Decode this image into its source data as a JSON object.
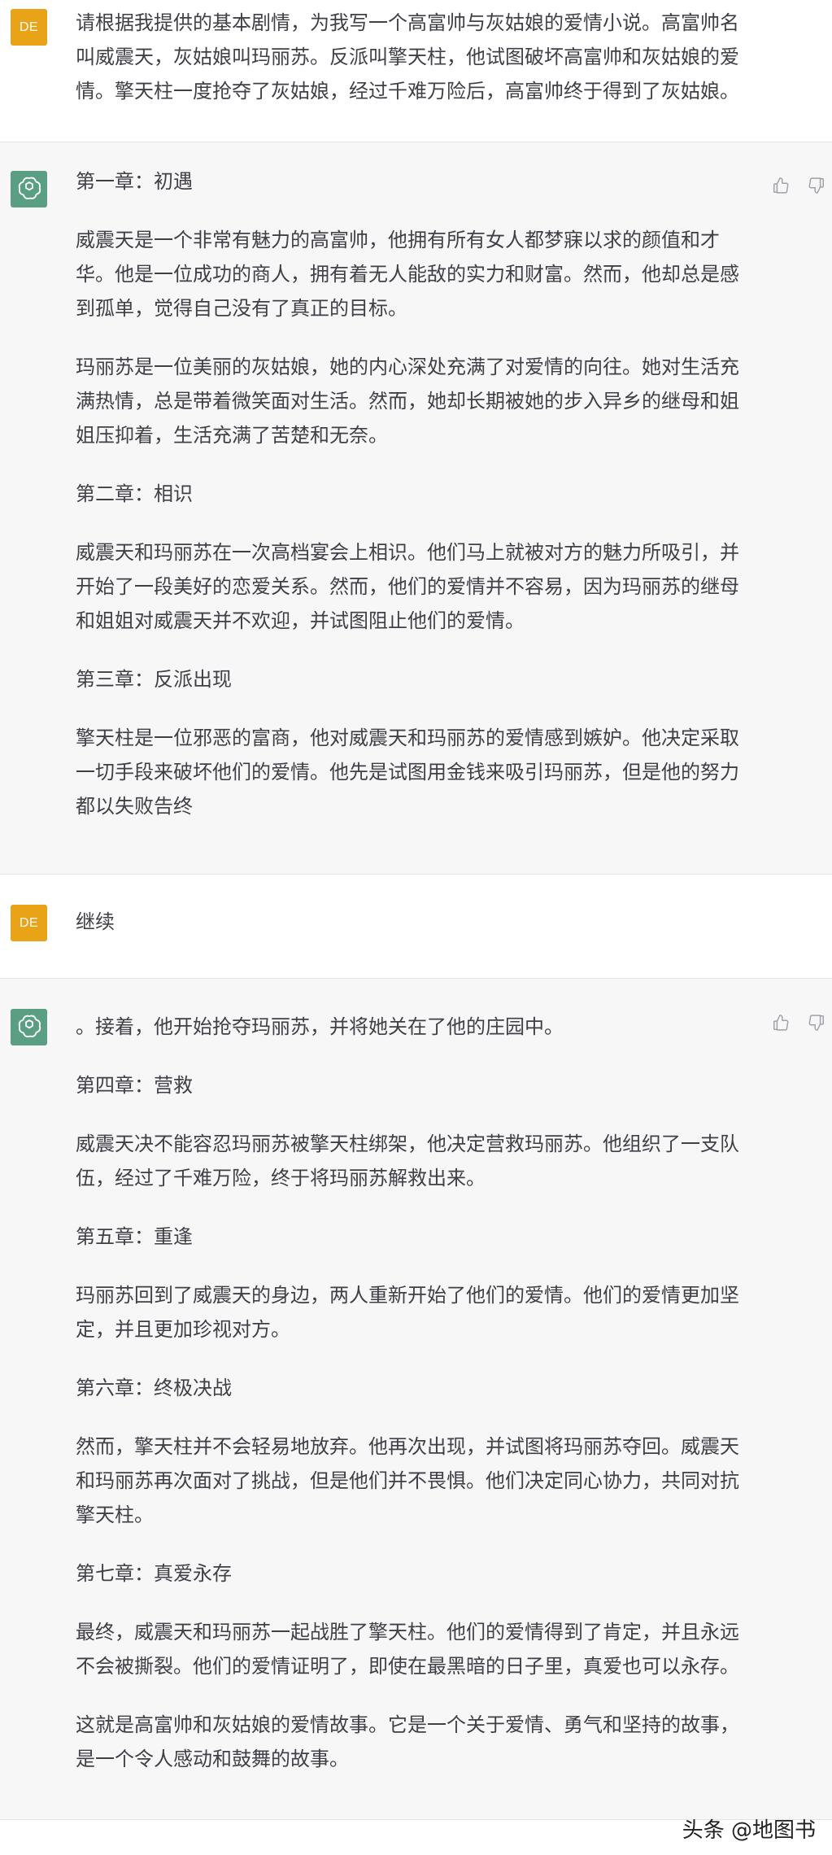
{
  "user_initials": "DE",
  "messages": {
    "m1": {
      "text": "请根据我提供的基本剧情，为我写一个高富帅与灰姑娘的爱情小说。高富帅名叫威震天，灰姑娘叫玛丽苏。反派叫擎天柱，他试图破坏高富帅和灰姑娘的爱情。擎天柱一度抢夺了灰姑娘，经过千难万险后，高富帅终于得到了灰姑娘。"
    },
    "m2": {
      "p1": "第一章：初遇",
      "p2": "威震天是一个非常有魅力的高富帅，他拥有所有女人都梦寐以求的颜值和才华。他是一位成功的商人，拥有着无人能敌的实力和财富。然而，他却总是感到孤单，觉得自己没有了真正的目标。",
      "p3": "玛丽苏是一位美丽的灰姑娘，她的内心深处充满了对爱情的向往。她对生活充满热情，总是带着微笑面对生活。然而，她却长期被她的步入异乡的继母和姐姐压抑着，生活充满了苦楚和无奈。",
      "p4": "第二章：相识",
      "p5": "威震天和玛丽苏在一次高档宴会上相识。他们马上就被对方的魅力所吸引，并开始了一段美好的恋爱关系。然而，他们的爱情并不容易，因为玛丽苏的继母和姐姐对威震天并不欢迎，并试图阻止他们的爱情。",
      "p6": "第三章：反派出现",
      "p7": "擎天柱是一位邪恶的富商，他对威震天和玛丽苏的爱情感到嫉妒。他决定采取一切手段来破坏他们的爱情。他先是试图用金钱来吸引玛丽苏，但是他的努力都以失败告终"
    },
    "m3": {
      "text": "继续"
    },
    "m4": {
      "p1": "。接着，他开始抢夺玛丽苏，并将她关在了他的庄园中。",
      "p2": "第四章：营救",
      "p3": "威震天决不能容忍玛丽苏被擎天柱绑架，他决定营救玛丽苏。他组织了一支队伍，经过了千难万险，终于将玛丽苏解救出来。",
      "p4": "第五章：重逢",
      "p5": "玛丽苏回到了威震天的身边，两人重新开始了他们的爱情。他们的爱情更加坚定，并且更加珍视对方。",
      "p6": "第六章：终极决战",
      "p7": "然而，擎天柱并不会轻易地放弃。他再次出现，并试图将玛丽苏夺回。威震天和玛丽苏再次面对了挑战，但是他们并不畏惧。他们决定同心协力，共同对抗擎天柱。",
      "p8": "第七章：真爱永存",
      "p9": "最终，威震天和玛丽苏一起战胜了擎天柱。他们的爱情得到了肯定，并且永远不会被撕裂。他们的爱情证明了，即使在最黑暗的日子里，真爱也可以永存。",
      "p10": "这就是高富帅和灰姑娘的爱情故事。它是一个关于爱情、勇气和坚持的故事，是一个令人感动和鼓舞的故事。"
    }
  },
  "icons": {
    "bot_avatar": "openai-logo-icon",
    "like": "thumbs-up-icon",
    "dislike": "thumbs-down-icon"
  },
  "colors": {
    "user_avatar_bg": "#e8a317",
    "bot_avatar_bg": "#5a9e83",
    "assistant_bg": "#f7f7f8"
  },
  "watermark": "头条 @地图书"
}
